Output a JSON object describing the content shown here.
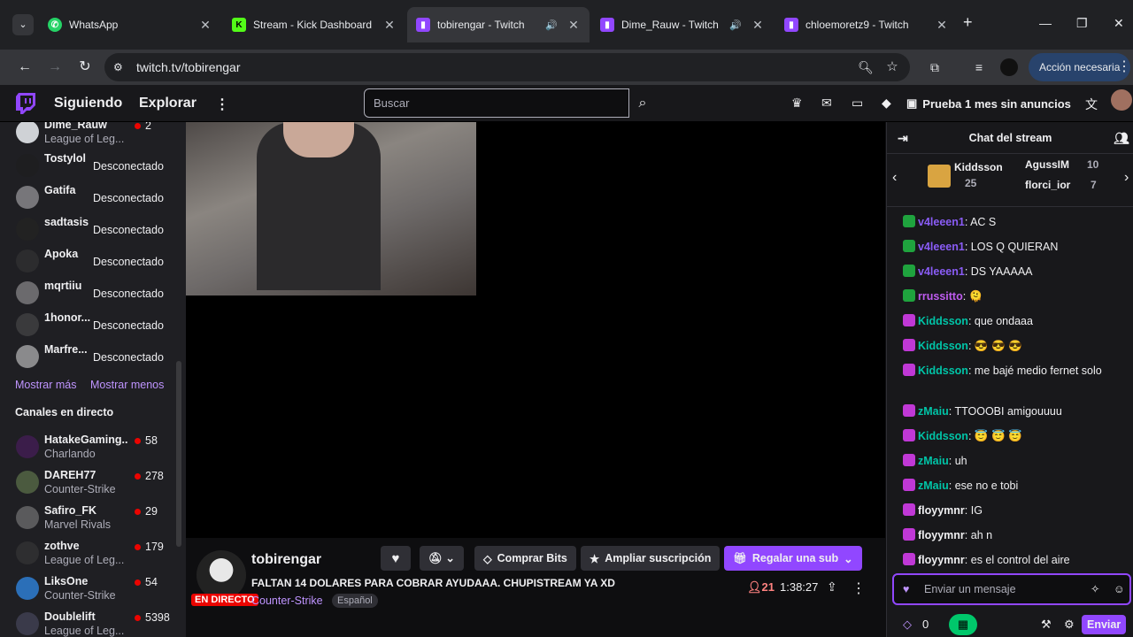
{
  "browser": {
    "tabs": [
      {
        "title": "WhatsApp",
        "icon": "whatsapp-icon",
        "color": "#25d366"
      },
      {
        "title": "Stream - Kick Dashboard",
        "icon": "kick-icon",
        "color": "#53fc18"
      },
      {
        "title": "tobirengar - Twitch",
        "icon": "twitch-icon",
        "color": "#9147ff",
        "active": true,
        "audio": true
      },
      {
        "title": "Dime_Rauw - Twitch",
        "icon": "twitch-icon",
        "color": "#9147ff",
        "audio": true
      },
      {
        "title": "chloemoretz9 - Twitch",
        "icon": "twitch-icon",
        "color": "#9147ff"
      }
    ],
    "url": "twitch.tv/tobirengar",
    "accion": "Acción necesaria"
  },
  "topnav": {
    "siguiendo": "Siguiendo",
    "explorar": "Explorar",
    "search_placeholder": "Buscar",
    "prime": "Prueba 1 mes sin anuncios"
  },
  "sidebar": {
    "followed": [
      {
        "name": "Dime_Rauw",
        "sub": "League of Leg...",
        "viewers": "2"
      },
      {
        "name": "Tostylol",
        "status": "Desconectado"
      },
      {
        "name": "Gatifa",
        "status": "Desconectado"
      },
      {
        "name": "sadtasis",
        "status": "Desconectado"
      },
      {
        "name": "Apoka",
        "status": "Desconectado"
      },
      {
        "name": "mqrtiiu",
        "status": "Desconectado"
      },
      {
        "name": "1honor...",
        "status": "Desconectado"
      },
      {
        "name": "Marfre...",
        "status": "Desconectado"
      }
    ],
    "show_more": "Mostrar más",
    "show_less": "Mostrar menos",
    "live_header": "Canales en directo",
    "live": [
      {
        "name": "HatakeGaming...",
        "sub": "Charlando",
        "viewers": "58"
      },
      {
        "name": "DAREH77",
        "sub": "Counter-Strike",
        "viewers": "278"
      },
      {
        "name": "Safiro_FK",
        "sub": "Marvel Rivals",
        "viewers": "29"
      },
      {
        "name": "zothve",
        "sub": "League of Leg...",
        "viewers": "179"
      },
      {
        "name": "LiksOne",
        "sub": "Counter-Strike",
        "viewers": "54"
      },
      {
        "name": "Doublelift",
        "sub": "League of Leg...",
        "viewers": "5398"
      }
    ]
  },
  "stream": {
    "channel": "tobirengar",
    "title": "FALTAN 14 DOLARES PARA COBRAR AYUDAAA. CHUPISTREAM YA XD",
    "live_badge": "EN DIRECTO",
    "game": "Counter-Strike",
    "language": "Español",
    "viewers": "21",
    "uptime": "1:38:27",
    "buttons": {
      "bits": "Comprar Bits",
      "ampliar": "Ampliar suscripción",
      "regalar": "Regalar una sub"
    }
  },
  "chat": {
    "header": "Chat del stream",
    "gifts": {
      "top_user": "Kiddsson",
      "top_count": "25",
      "second_user": "AgussIM",
      "second_count": "10",
      "third_user": "florci_ior",
      "third_count": "7"
    },
    "messages": [
      {
        "user": "v4leeen1",
        "text": "AC S",
        "color": "#8a5cf6"
      },
      {
        "user": "v4leeen1",
        "text": "LOS Q QUIERAN",
        "color": "#8a5cf6"
      },
      {
        "user": "v4leeen1",
        "text": "DS YAAAAA",
        "color": "#8a5cf6"
      },
      {
        "user": "rrussitto",
        "text": "🫠",
        "color": "#bf5cf0"
      },
      {
        "user": "Kiddsson",
        "text": "que ondaaa",
        "color": "#00c4a7"
      },
      {
        "user": "Kiddsson",
        "text": "😎 😎 😎",
        "color": "#00c4a7"
      },
      {
        "user": "Kiddsson",
        "text": "me bajé medio fernet solo",
        "color": "#00c4a7"
      },
      {
        "user": "zMaiu",
        "text": "TTOOOBI amigouuuu",
        "color": "#00c4a7"
      },
      {
        "user": "Kiddsson",
        "text": "😇 😇 😇",
        "color": "#00c4a7"
      },
      {
        "user": "zMaiu",
        "text": "uh",
        "color": "#00c4a7"
      },
      {
        "user": "zMaiu",
        "text": "ese no e tobi",
        "color": "#00c4a7"
      },
      {
        "user": "floyymnr",
        "text": "IG",
        "color": "#efeff1"
      },
      {
        "user": "floyymnr",
        "text": "ah n",
        "color": "#efeff1"
      },
      {
        "user": "floyymnr",
        "text": "es el control del aire",
        "color": "#efeff1"
      }
    ],
    "input_placeholder": "Enviar un mensaje",
    "points": "0",
    "send": "Enviar"
  }
}
